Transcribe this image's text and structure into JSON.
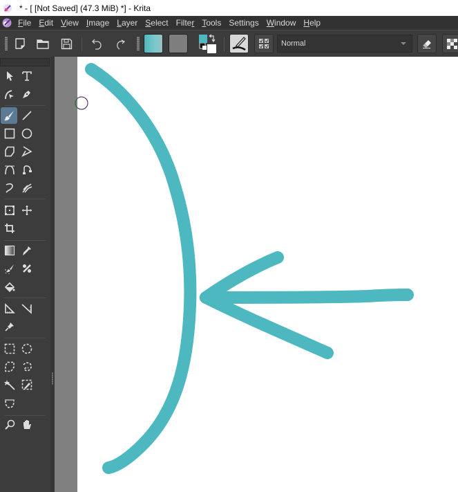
{
  "window": {
    "title": "* - [ [Not Saved]  (47.3 MiB) *] - Krita",
    "app_icon": "krita-icon"
  },
  "menubar": {
    "items": [
      {
        "label": "File",
        "mnemonic": "F"
      },
      {
        "label": "Edit",
        "mnemonic": "E"
      },
      {
        "label": "View",
        "mnemonic": "V"
      },
      {
        "label": "Image",
        "mnemonic": "I"
      },
      {
        "label": "Layer",
        "mnemonic": "L"
      },
      {
        "label": "Select",
        "mnemonic": "S"
      },
      {
        "label": "Filter",
        "mnemonic": "r"
      },
      {
        "label": "Tools",
        "mnemonic": "T"
      },
      {
        "label": "Settings",
        "mnemonic": "g"
      },
      {
        "label": "Window",
        "mnemonic": "W"
      },
      {
        "label": "Help",
        "mnemonic": "H"
      }
    ]
  },
  "toolbar": {
    "buttons": [
      "new-document",
      "open-document",
      "save-document",
      "undo",
      "redo"
    ],
    "gradient_preset": "gradient-swatch",
    "pattern_preset": "pattern-swatch",
    "foreground_color": "#4db8c0",
    "background_color": "#ffffff",
    "brush_preset": "brush-preset-icon",
    "brush_editor": "brush-settings-icon",
    "blend_mode": "Normal",
    "eraser_mode": "eraser-icon",
    "alpha_lock": "alpha-lock-icon"
  },
  "toolbox": {
    "tools": [
      "select-shapes",
      "text",
      "edit-shapes",
      "calligraphy",
      "freehand-brush",
      "line",
      "rectangle",
      "ellipse",
      "polygon",
      "polyline",
      "bezier-curve",
      "freehand-path",
      "dynamic-brush",
      "multibrush",
      "transform",
      "move",
      "crop",
      "gradient",
      "color-sampler",
      "colorize-mask",
      "smart-patch",
      "fill",
      "assistant",
      "measure",
      "reference-images",
      "rectangular-selection",
      "elliptical-selection",
      "polygonal-selection",
      "freehand-selection",
      "contiguous-selection",
      "similar-color-selection",
      "bezier-selection",
      "zoom",
      "pan"
    ],
    "active_tool": "freehand-brush"
  },
  "canvas": {
    "stroke_color": "#4db8c0",
    "strokes": [
      "curved-bracket-stroke",
      "arrow-shaft-stroke",
      "arrow-head-upper-stroke",
      "arrow-head-lower-stroke"
    ],
    "cursor": "brush-outline-cursor"
  }
}
